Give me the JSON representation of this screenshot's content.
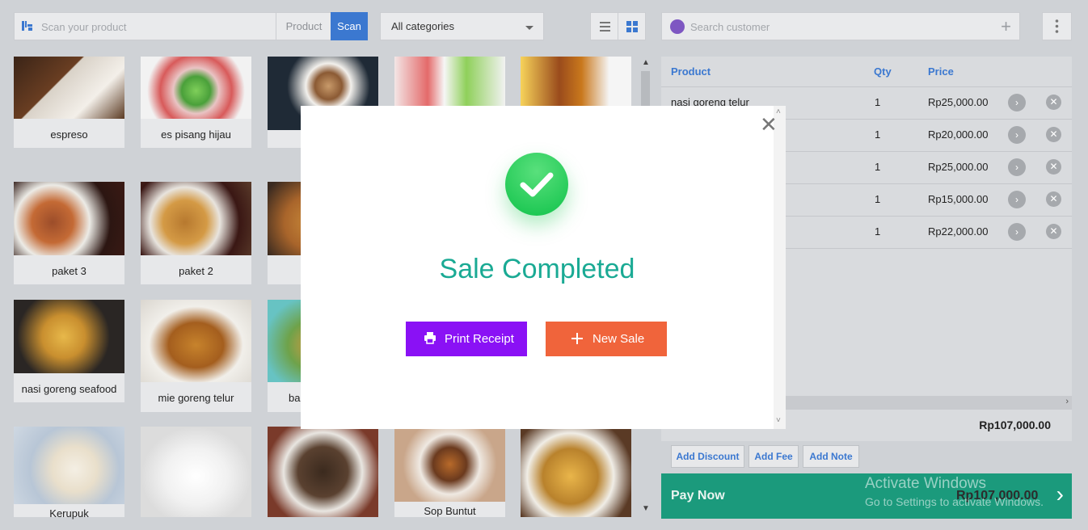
{
  "toolbar": {
    "scan_placeholder": "Scan your product",
    "product_label": "Product",
    "scan_label": "Scan",
    "category_selected": "All categories",
    "customer_placeholder": "Search customer"
  },
  "products": [
    {
      "name": "espreso"
    },
    {
      "name": "es pisang hijau"
    },
    {
      "name": ""
    },
    {
      "name": ""
    },
    {
      "name": ""
    },
    {
      "name": "paket 3"
    },
    {
      "name": "paket 2"
    },
    {
      "name": "nasi goreng seafood"
    },
    {
      "name": "mie goreng telur"
    },
    {
      "name": "ba"
    },
    {
      "name": "Kerupuk"
    },
    {
      "name": ""
    },
    {
      "name": ""
    },
    {
      "name": "Sop Buntut"
    },
    {
      "name": ""
    }
  ],
  "cart": {
    "headers": {
      "product": "Product",
      "qty": "Qty",
      "price": "Price"
    },
    "items": [
      {
        "product": "nasi goreng telur",
        "qty": "1",
        "price": "Rp25,000.00"
      },
      {
        "product": "",
        "qty": "1",
        "price": "Rp20,000.00"
      },
      {
        "product": "",
        "qty": "1",
        "price": "Rp25,000.00"
      },
      {
        "product": "",
        "qty": "1",
        "price": "Rp15,000.00"
      },
      {
        "product": "",
        "qty": "1",
        "price": "Rp22,000.00"
      }
    ],
    "total": "Rp107,000.00",
    "add_discount": "Add Discount",
    "add_fee": "Add Fee",
    "add_note": "Add Note",
    "pay_now": "Pay Now",
    "pay_amount": "Rp107,000.00"
  },
  "watermark": {
    "line1": "Activate Windows",
    "line2": "Go to Settings to activate Windows."
  },
  "modal": {
    "title": "Sale Completed",
    "print_receipt": "Print Receipt",
    "new_sale": "New Sale"
  },
  "colors": {
    "accent_blue": "#3b78d0",
    "print_button": "#8a11f5",
    "new_sale_button": "#f0643b",
    "success_text": "#1aaa94",
    "pay_bar": "#1b9a7c"
  }
}
